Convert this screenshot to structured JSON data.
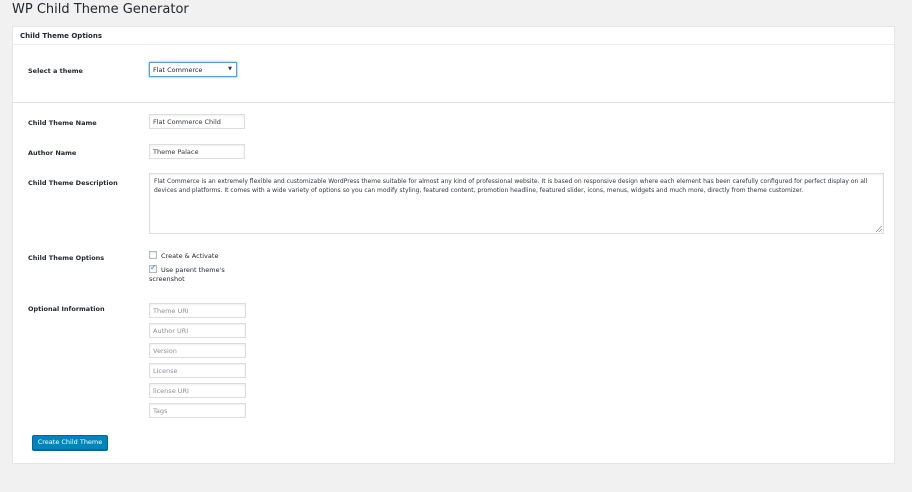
{
  "page": {
    "title": "WP Child Theme Generator"
  },
  "panel": {
    "header": "Child Theme Options"
  },
  "form": {
    "select_theme": {
      "label": "Select a theme",
      "value": "Flat Commerce"
    },
    "child_theme_name": {
      "label": "Child Theme Name",
      "value": "Flat Commerce Child"
    },
    "author_name": {
      "label": "Author Name",
      "value": "Theme Palace"
    },
    "description": {
      "label": "Child Theme Description",
      "value": "Flat Commerce is an extremely flexible and customizable WordPress theme suitable for almost any kind of professional website. It is based on responsive design where each element has been carefully configured for perfect display on all devices and platforms. It comes with a wide variety of options so you can modify styling, featured content, promotion headline, featured slider, icons, menus, widgets and much more, directly from theme customizer."
    },
    "options": {
      "label": "Child Theme Options",
      "create_activate": {
        "label": "Create & Activate",
        "checked": false
      },
      "use_parent_screenshot": {
        "label_line1": "Use parent theme's",
        "label_line2": "screenshot",
        "checked": true
      }
    },
    "optional": {
      "label": "Optional Information",
      "theme_uri": {
        "placeholder": "Theme URI"
      },
      "author_uri": {
        "placeholder": "Author URI"
      },
      "version": {
        "placeholder": "Version"
      },
      "license": {
        "placeholder": "License"
      },
      "license_uri": {
        "placeholder": "license URI"
      },
      "tags": {
        "placeholder": "Tags"
      }
    },
    "submit_label": "Create Child Theme"
  },
  "colors": {
    "primary_button": "#0085ba",
    "focus_border": "#5b9dd9"
  }
}
